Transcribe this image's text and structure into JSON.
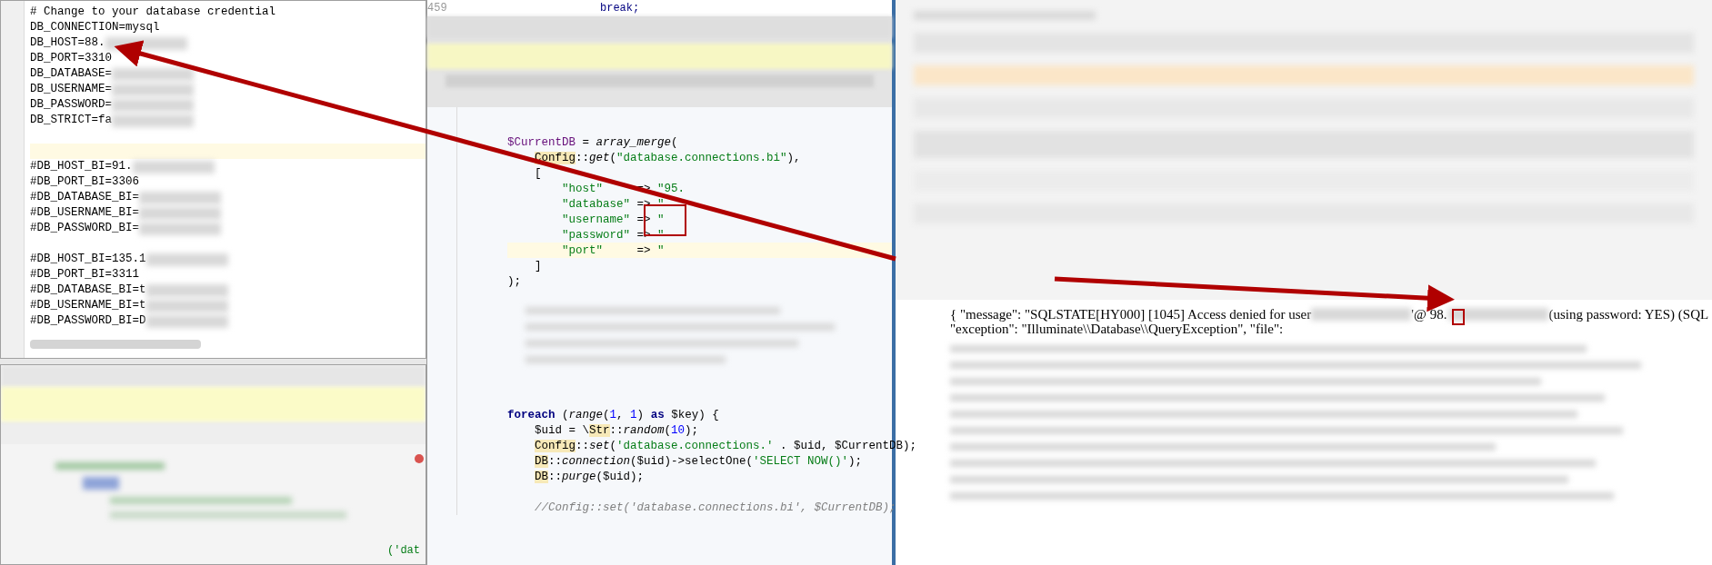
{
  "env_editor": {
    "lines": [
      {
        "text": "# Change to your database credential",
        "redacted": false
      },
      {
        "text": "DB_CONNECTION=mysql",
        "redacted": false
      },
      {
        "text": "DB_HOST=88.",
        "redacted": true
      },
      {
        "text": "DB_PORT=3310",
        "redacted": false
      },
      {
        "text": "DB_DATABASE=",
        "redacted": true
      },
      {
        "text": "DB_USERNAME=",
        "redacted": true
      },
      {
        "text": "DB_PASSWORD=",
        "redacted": true
      },
      {
        "text": "DB_STRICT=fa",
        "redacted": true
      },
      {
        "redacted": false
      },
      {
        "redacted": false
      },
      {
        "text": "#DB_HOST_BI=91.",
        "redacted": true
      },
      {
        "text": "#DB_PORT_BI=3306",
        "redacted": false
      },
      {
        "text": "#DB_DATABASE_BI=",
        "redacted": true
      },
      {
        "text": "#DB_USERNAME_BI=",
        "redacted": true
      },
      {
        "text": "#DB_PASSWORD_BI=",
        "redacted": true
      },
      {
        "redacted": false
      },
      {
        "text": "#DB_HOST_BI=135.1",
        "redacted": true
      },
      {
        "text": "#DB_PORT_BI=3311",
        "redacted": false
      },
      {
        "text": "#DB_DATABASE_BI=t",
        "redacted": true
      },
      {
        "text": "#DB_USERNAME_BI=t",
        "redacted": true
      },
      {
        "text": "#DB_PASSWORD_BI=D",
        "redacted": true
      }
    ]
  },
  "lower_editor": {
    "visible_code": "('dat"
  },
  "php_editor": {
    "top_line": {
      "number": "459",
      "code": "break;"
    },
    "block_1": [
      [
        {
          "t": "$CurrentDB",
          "kind": "var"
        },
        {
          "t": " = ",
          "kind": "plain"
        },
        {
          "t": "array_merge",
          "kind": "italic"
        },
        {
          "t": "(",
          "kind": "plain"
        }
      ],
      [
        {
          "t": "Config",
          "kind": "cls"
        },
        {
          "t": "::",
          "kind": "plain"
        },
        {
          "t": "get",
          "kind": "italic"
        },
        {
          "t": "(",
          "kind": "plain"
        },
        {
          "t": "\"database.connections.bi\"",
          "kind": "string"
        },
        {
          "t": "),",
          "kind": "plain"
        }
      ],
      [
        {
          "t": "[",
          "kind": "plain"
        }
      ],
      [
        {
          "t": "\"host\"     ",
          "kind": "string"
        },
        {
          "t": "=> ",
          "kind": "plain"
        },
        {
          "t": "\"95.",
          "kind": "string"
        }
      ],
      [
        {
          "t": "\"database\" ",
          "kind": "string"
        },
        {
          "t": "=> ",
          "kind": "plain"
        },
        {
          "t": "\"",
          "kind": "string"
        }
      ],
      [
        {
          "t": "\"username\" ",
          "kind": "string"
        },
        {
          "t": "=> ",
          "kind": "plain"
        },
        {
          "t": "\"",
          "kind": "string"
        }
      ],
      [
        {
          "t": "\"password\" ",
          "kind": "string"
        },
        {
          "t": "=> ",
          "kind": "plain"
        },
        {
          "t": "\"",
          "kind": "string"
        }
      ],
      [
        {
          "t": "\"port\"     ",
          "kind": "string"
        },
        {
          "t": "=> ",
          "kind": "plain"
        },
        {
          "t": "\"",
          "kind": "string"
        }
      ],
      [
        {
          "t": "]",
          "kind": "plain"
        }
      ],
      [
        {
          "t": ");",
          "kind": "plain"
        }
      ]
    ],
    "block_2": [
      [
        {
          "t": "foreach",
          "kind": "keyword"
        },
        {
          "t": " (",
          "kind": "plain"
        },
        {
          "t": "range",
          "kind": "italic"
        },
        {
          "t": "(",
          "kind": "plain"
        },
        {
          "t": "1",
          "kind": "number"
        },
        {
          "t": ", ",
          "kind": "plain"
        },
        {
          "t": "1",
          "kind": "number"
        },
        {
          "t": ") ",
          "kind": "plain"
        },
        {
          "t": "as",
          "kind": "keyword"
        },
        {
          "t": " $key) {",
          "kind": "plain"
        }
      ],
      [
        {
          "t": "$uid = \\",
          "kind": "plain"
        },
        {
          "t": "Str",
          "kind": "cls"
        },
        {
          "t": "::",
          "kind": "plain"
        },
        {
          "t": "random",
          "kind": "italic"
        },
        {
          "t": "(",
          "kind": "plain"
        },
        {
          "t": "10",
          "kind": "number"
        },
        {
          "t": ");",
          "kind": "plain"
        }
      ],
      [
        {
          "t": "Config",
          "kind": "cls"
        },
        {
          "t": "::",
          "kind": "plain"
        },
        {
          "t": "set",
          "kind": "italic"
        },
        {
          "t": "(",
          "kind": "plain"
        },
        {
          "t": "'database.connections.'",
          "kind": "string"
        },
        {
          "t": " . $uid, $CurrentDB);",
          "kind": "plain"
        }
      ],
      [
        {
          "t": "DB",
          "kind": "cls"
        },
        {
          "t": "::",
          "kind": "plain"
        },
        {
          "t": "connection",
          "kind": "italic"
        },
        {
          "t": "($uid)->selectOne(",
          "kind": "plain"
        },
        {
          "t": "'SELECT NOW()'",
          "kind": "string"
        },
        {
          "t": ");",
          "kind": "plain"
        }
      ],
      [
        {
          "t": "DB",
          "kind": "cls"
        },
        {
          "t": "::",
          "kind": "plain"
        },
        {
          "t": "purge",
          "kind": "italic"
        },
        {
          "t": "($uid);",
          "kind": "plain"
        }
      ],
      [
        {
          "t": "//Config::set('database.connections.bi', $CurrentDB);",
          "kind": "comment"
        }
      ]
    ]
  },
  "error_page": {
    "line_1": [
      {
        "t": "{ \"message\": \"SQLSTATE[HY000] [1045] Access denied for user",
        "redacted": false
      },
      {
        "redacted": true
      },
      {
        "t": "'@",
        "redacted": false
      },
      {
        "t": "98.",
        "redacted": false
      },
      {
        "redacted": true
      },
      {
        "t": "(using password: YES) (SQL",
        "redacted": false
      }
    ],
    "line_2": "\"exception\": \"Illuminate\\\\Database\\\\QueryException\", \"file\":"
  }
}
